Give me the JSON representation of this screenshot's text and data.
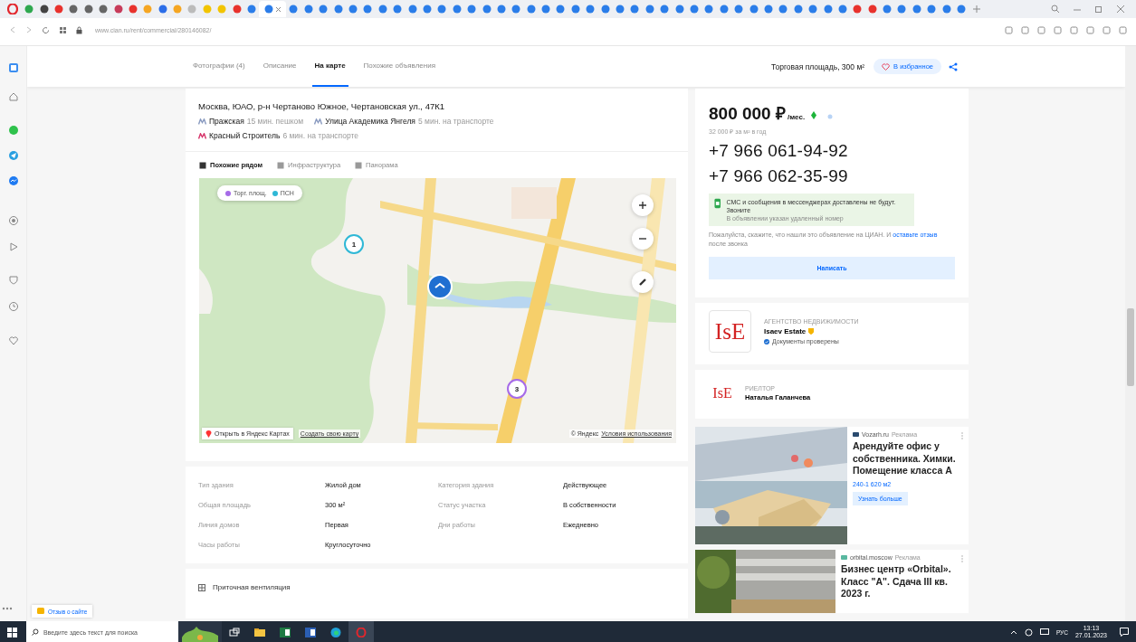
{
  "browser": {
    "tabs": [
      {
        "color": "#2fa84f",
        "selected": false
      },
      {
        "color": "#444444",
        "selected": false
      },
      {
        "color": "#e8322d",
        "selected": false
      },
      {
        "color": "#666666",
        "selected": false
      },
      {
        "color": "#666666",
        "selected": false
      },
      {
        "color": "#666666",
        "selected": false
      },
      {
        "color": "#c73b5a",
        "selected": false
      },
      {
        "color": "#e8322d",
        "selected": false
      },
      {
        "color": "#f5a623",
        "selected": false
      },
      {
        "color": "#2b6de8",
        "selected": false
      },
      {
        "color": "#f5a623",
        "selected": false
      },
      {
        "color": "#bbbbbb",
        "selected": false
      },
      {
        "color": "#f2c400",
        "selected": false
      },
      {
        "color": "#f2c400",
        "selected": false
      },
      {
        "color": "#e8322d",
        "selected": false
      },
      {
        "color": "#2b7de9",
        "selected": false
      },
      {
        "color": "#2b7de9",
        "selected": true
      },
      {
        "color": "#2b7de9",
        "selected": false
      },
      {
        "color": "#2b7de9",
        "selected": false
      },
      {
        "color": "#2b7de9",
        "selected": false
      },
      {
        "color": "#2b7de9",
        "selected": false
      },
      {
        "color": "#2b7de9",
        "selected": false
      },
      {
        "color": "#2b7de9",
        "selected": false
      },
      {
        "color": "#2b7de9",
        "selected": false
      },
      {
        "color": "#2b7de9",
        "selected": false
      },
      {
        "color": "#2b7de9",
        "selected": false
      },
      {
        "color": "#2b7de9",
        "selected": false
      },
      {
        "color": "#2b7de9",
        "selected": false
      },
      {
        "color": "#2b7de9",
        "selected": false
      },
      {
        "color": "#2b7de9",
        "selected": false
      },
      {
        "color": "#2b7de9",
        "selected": false
      },
      {
        "color": "#2b7de9",
        "selected": false
      },
      {
        "color": "#2b7de9",
        "selected": false
      },
      {
        "color": "#2b7de9",
        "selected": false
      },
      {
        "color": "#2b7de9",
        "selected": false
      },
      {
        "color": "#2b7de9",
        "selected": false
      },
      {
        "color": "#2b7de9",
        "selected": false
      },
      {
        "color": "#2b7de9",
        "selected": false
      },
      {
        "color": "#2b7de9",
        "selected": false
      },
      {
        "color": "#2b7de9",
        "selected": false
      },
      {
        "color": "#2b7de9",
        "selected": false
      },
      {
        "color": "#2b7de9",
        "selected": false
      },
      {
        "color": "#2b7de9",
        "selected": false
      },
      {
        "color": "#2b7de9",
        "selected": false
      },
      {
        "color": "#2b7de9",
        "selected": false
      },
      {
        "color": "#2b7de9",
        "selected": false
      },
      {
        "color": "#2b7de9",
        "selected": false
      },
      {
        "color": "#2b7de9",
        "selected": false
      },
      {
        "color": "#2b7de9",
        "selected": false
      },
      {
        "color": "#2b7de9",
        "selected": false
      },
      {
        "color": "#2b7de9",
        "selected": false
      },
      {
        "color": "#2b7de9",
        "selected": false
      },
      {
        "color": "#2b7de9",
        "selected": false
      },
      {
        "color": "#2b7de9",
        "selected": false
      },
      {
        "color": "#2b7de9",
        "selected": false
      },
      {
        "color": "#e8322d",
        "selected": false
      },
      {
        "color": "#e8322d",
        "selected": false
      },
      {
        "color": "#2b7de9",
        "selected": false
      },
      {
        "color": "#2b7de9",
        "selected": false
      },
      {
        "color": "#2b7de9",
        "selected": false
      },
      {
        "color": "#2b7de9",
        "selected": false
      },
      {
        "color": "#2b7de9",
        "selected": false
      },
      {
        "color": "#2b7de9",
        "selected": false
      }
    ],
    "address": "www.cian.ru/rent/commercial/280146082/"
  },
  "header": {
    "nav": [
      {
        "label": "Фотографии (4)",
        "selected": false
      },
      {
        "label": "Описание",
        "selected": false
      },
      {
        "label": "На карте",
        "selected": true
      },
      {
        "label": "Похожие объявления",
        "selected": false
      }
    ],
    "title": "Торговая площадь, 300 м²",
    "favorite": "В избранное"
  },
  "location": {
    "address": "Москва, ЮАО, р-н Чертаново Южное, Чертановская ул., 47К1",
    "metro": [
      {
        "station": "Пражская",
        "time": "15 мин. пешком",
        "color": "#8a9bc0"
      },
      {
        "station": "Улица Академика Янгеля",
        "time": "5 мин. на транспорте",
        "color": "#8a9bc0"
      },
      {
        "station": "Красный Строитель",
        "time": "6 мин. на транспорте",
        "color": "#d6366b"
      }
    ]
  },
  "map": {
    "tabs": [
      {
        "label": "Похожие рядом",
        "selected": true
      },
      {
        "label": "Инфраструктура",
        "selected": false
      },
      {
        "label": "Панорама",
        "selected": false
      }
    ],
    "legend": [
      {
        "label": "Торг. площ.",
        "color": "#a66be8"
      },
      {
        "label": "ПСН",
        "color": "#2fb8d6"
      }
    ],
    "clusters": [
      {
        "count": "1",
        "color": "#2fb8d6"
      },
      {
        "count": "3",
        "color": "#a66be8"
      }
    ],
    "open_link": "Открыть в Яндекс Картах",
    "create_link": "Создать свою карту",
    "copyright": "© Яндекс",
    "terms": "Условия использования"
  },
  "details": [
    {
      "label": "Тип здания",
      "value": "Жилой дом"
    },
    {
      "label": "Категория здания",
      "value": "Действующее"
    },
    {
      "label": "Общая площадь",
      "value": "300 м²"
    },
    {
      "label": "Статус участка",
      "value": "В собственности"
    },
    {
      "label": "Линия домов",
      "value": "Первая"
    },
    {
      "label": "Дни работы",
      "value": "Ежедневно"
    },
    {
      "label": "Часы работы",
      "value": "Круглосуточно"
    }
  ],
  "features": [
    {
      "label": "Приточная вентиляция"
    }
  ],
  "offer": {
    "price": "800 000 ₽",
    "period": "/мес.",
    "per_meter": "32 000 ₽ за м² в год",
    "phones": [
      "+7 966 061-94-92",
      "+7 966 062-35-99"
    ],
    "notice": "СМС и сообщения в мессенджерах доставлены не будут. Звоните",
    "notice_note": "В объявлении указан удаленный номер",
    "hint": "Пожалуйста, скажите, что нашли это объявление на ЦИАН. И",
    "hint_link": "оставьте отзыв",
    "hint_end": "после звонка",
    "write_button": "Написать"
  },
  "agency": {
    "logo": "IsE",
    "label": "АГЕНТСТВО НЕДВИЖИМОСТИ",
    "name": "Isaev Estate",
    "verified": "Документы проверены"
  },
  "realtor": {
    "logo": "IsE",
    "label": "РИЕЛТОР",
    "name": "Наталья Галанчева"
  },
  "ads": [
    {
      "kind": "picture",
      "source": "Vozarh.ru",
      "tag": "Реклама",
      "title": "Арендуйте офис у собственника. Химки. Помещение класса А",
      "subtitle": "240-1 620 м2",
      "button": "Узнать больше"
    },
    {
      "kind": "picture",
      "source": "orbital.moscow",
      "tag": "Реклама",
      "title": "Бизнес центр «Orbital». Класс \"A\". Сдача III кв. 2023 г."
    }
  ],
  "feedback_button": "Отзыв о сайте",
  "taskbar": {
    "search_placeholder": "Введите здесь текст для поиска",
    "language": "РУС",
    "time": "13:13",
    "date": "27.01.2023"
  }
}
